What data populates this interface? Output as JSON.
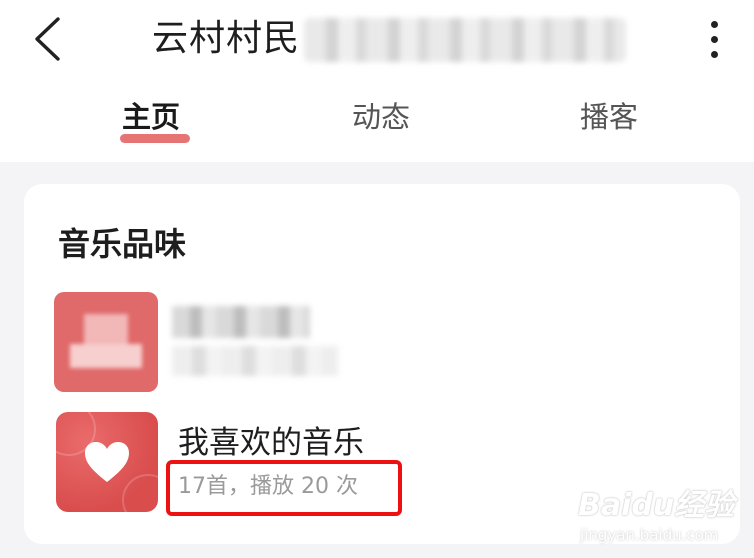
{
  "header": {
    "title": "云村村民",
    "back_icon": "chevron-left-icon",
    "more_icon": "vertical-dots-icon"
  },
  "tabs": [
    {
      "label": "主页",
      "active": true
    },
    {
      "label": "动态",
      "active": false
    },
    {
      "label": "播客",
      "active": false
    }
  ],
  "colors": {
    "accent": "#e25c5c",
    "highlight": "#ee1111",
    "cover_red": "#d94d4d"
  },
  "music_taste": {
    "section_title": "音乐品味",
    "playlists": [
      {
        "name": "我喜欢的音乐",
        "stats": "17首，播放 20 次",
        "cover_icon": "heart-icon"
      }
    ]
  },
  "watermark": {
    "logo": "Baidu经验",
    "url": "jingyan.baidu.com"
  }
}
